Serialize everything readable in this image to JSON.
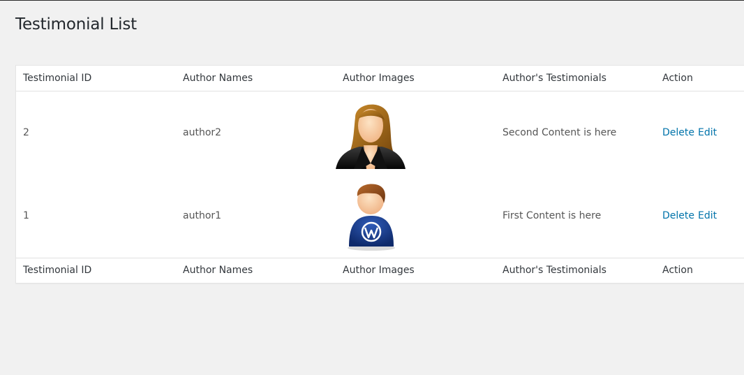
{
  "page": {
    "title": "Testimonial List"
  },
  "table": {
    "columns": [
      "Testimonial ID",
      "Author Names",
      "Author Images",
      "Author's Testimonials",
      "Action"
    ],
    "rows": [
      {
        "id": "2",
        "author_name": "author2",
        "author_image": "female-avatar-icon",
        "testimonial": "Second Content is here",
        "actions": {
          "delete": "Delete",
          "edit": "Edit"
        }
      },
      {
        "id": "1",
        "author_name": "author1",
        "author_image": "male-wordpress-avatar-icon",
        "testimonial": "First Content is here",
        "actions": {
          "delete": "Delete",
          "edit": "Edit"
        }
      }
    ]
  },
  "colors": {
    "background": "#f1f1f1",
    "link": "#0073aa",
    "table_background": "#ffffff"
  }
}
